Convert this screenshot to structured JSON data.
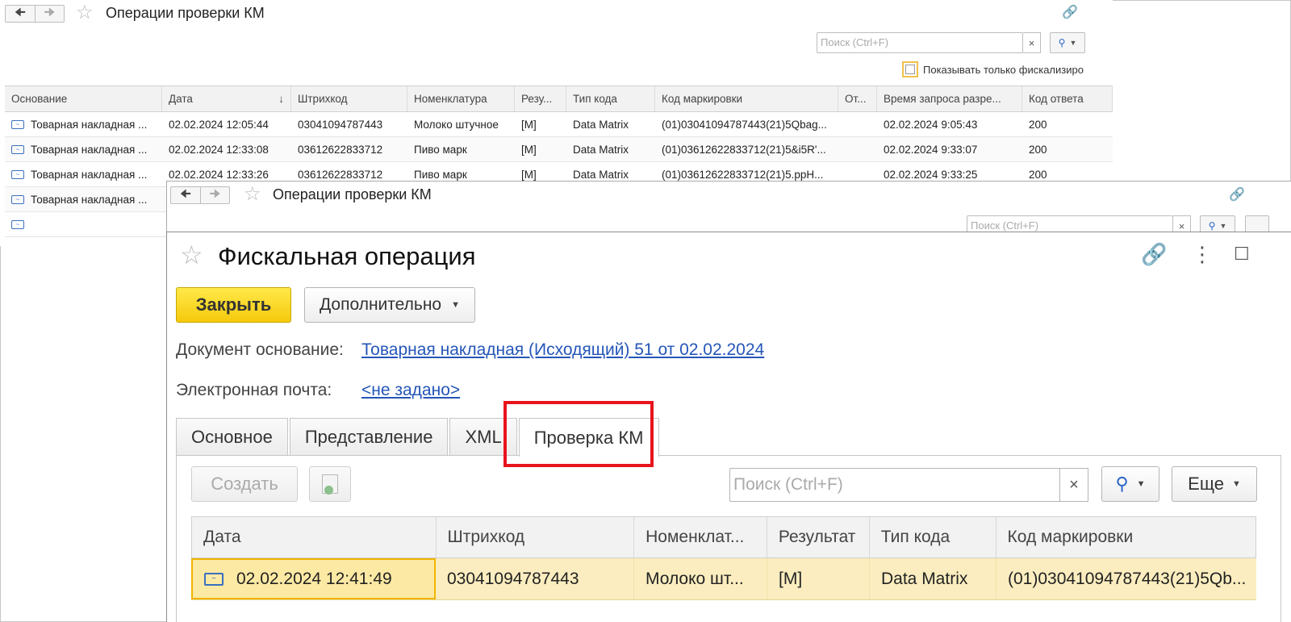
{
  "window1": {
    "title": "Операции проверки КМ",
    "search_placeholder": "Поиск (Ctrl+F)",
    "clear_label": "×",
    "checkbox_label": "Показывать только фискализиро",
    "columns": [
      "Основание",
      "Дата",
      "Штрихкод",
      "Номенклатура",
      "Резу...",
      "Тип кода",
      "Код маркировки",
      "От...",
      "Время запроса разре...",
      "Код ответа"
    ],
    "sort_indicator": "↓",
    "rows": [
      [
        "Товарная накладная ...",
        "02.02.2024 12:05:44",
        "03041094787443",
        "Молоко штучное",
        "[M]",
        "Data Matrix",
        "(01)03041094787443(21)5Qbag...",
        "",
        "02.02.2024 9:05:43",
        "200"
      ],
      [
        "Товарная накладная ...",
        "02.02.2024 12:33:08",
        "03612622833712",
        "Пиво марк",
        "[M]",
        "Data Matrix",
        "(01)03612622833712(21)5&i5R'...",
        "",
        "02.02.2024 9:33:07",
        "200"
      ],
      [
        "Товарная накладная ...",
        "02.02.2024 12:33:26",
        "03612622833712",
        "Пиво марк",
        "[M]",
        "Data Matrix",
        "(01)03612622833712(21)5.ppH...",
        "",
        "02.02.2024 9:33:25",
        "200"
      ],
      [
        "Товарная накладная ...",
        "",
        "",
        "",
        "",
        "",
        "",
        "",
        "",
        ""
      ],
      [
        "",
        "",
        "",
        "",
        "",
        "",
        "",
        "",
        "",
        ""
      ]
    ]
  },
  "window2": {
    "title": "Операции проверки КМ",
    "search_placeholder": "Поиск (Ctrl+F)",
    "clear_label": "×"
  },
  "form": {
    "title": "Фискальная операция",
    "close_button": "Закрыть",
    "more_button": "Дополнительно",
    "doc_label": "Документ основание:",
    "doc_link": "Товарная накладная (Исходящий) 51 от 02.02.2024",
    "email_label": "Электронная почта:",
    "email_link": "<не задано>",
    "tabs": [
      "Основное",
      "Представление",
      "XML",
      "Проверка КМ"
    ],
    "active_tab": "Проверка КМ",
    "create_button": "Создать",
    "search_placeholder": "Поиск (Ctrl+F)",
    "clear_label": "×",
    "eshche_button": "Еще",
    "columns": [
      "Дата",
      "Штрихкод",
      "Номенклат...",
      "Результат",
      "Тип кода",
      "Код маркировки"
    ],
    "rows": [
      [
        "02.02.2024 12:41:49",
        "03041094787443",
        "Молоко шт...",
        "[M]",
        "Data Matrix",
        "(01)03041094787443(21)5Qb..."
      ]
    ]
  },
  "colors": {
    "accent_yellow": "#f5c90c",
    "highlight_red": "#e8141c",
    "link_blue": "#2456b8",
    "selected_row": "#fbedbf"
  }
}
